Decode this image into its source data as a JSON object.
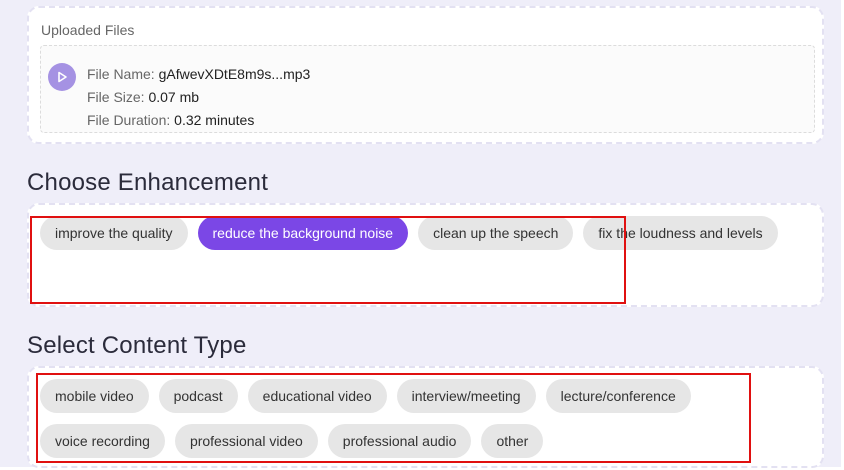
{
  "uploaded_files": {
    "title": "Uploaded Files",
    "file": {
      "name_label": "File Name:",
      "name_value": "gAfwevXDtE8m9s...mp3",
      "size_label": "File Size:",
      "size_value": "0.07 mb",
      "duration_label": "File Duration:",
      "duration_value": "0.32 minutes",
      "icon": "play-icon"
    }
  },
  "enhancement": {
    "title": "Choose Enhancement",
    "options": [
      {
        "label": "improve the quality",
        "selected": false
      },
      {
        "label": "reduce the background noise",
        "selected": true
      },
      {
        "label": "clean up the speech",
        "selected": false
      },
      {
        "label": "fix the loudness and levels",
        "selected": false
      }
    ]
  },
  "content_type": {
    "title": "Select Content Type",
    "options": [
      {
        "label": "mobile video",
        "selected": false
      },
      {
        "label": "podcast",
        "selected": false
      },
      {
        "label": "educational video",
        "selected": false
      },
      {
        "label": "interview/meeting",
        "selected": false
      },
      {
        "label": "lecture/conference",
        "selected": false
      },
      {
        "label": "voice recording",
        "selected": false
      },
      {
        "label": "professional video",
        "selected": false
      },
      {
        "label": "professional audio",
        "selected": false
      },
      {
        "label": "other",
        "selected": false
      }
    ]
  },
  "colors": {
    "accent": "#7b47e6",
    "highlight_box": "#e01010",
    "page_background": "#efeef9",
    "chip_background": "#e6e6e6"
  }
}
